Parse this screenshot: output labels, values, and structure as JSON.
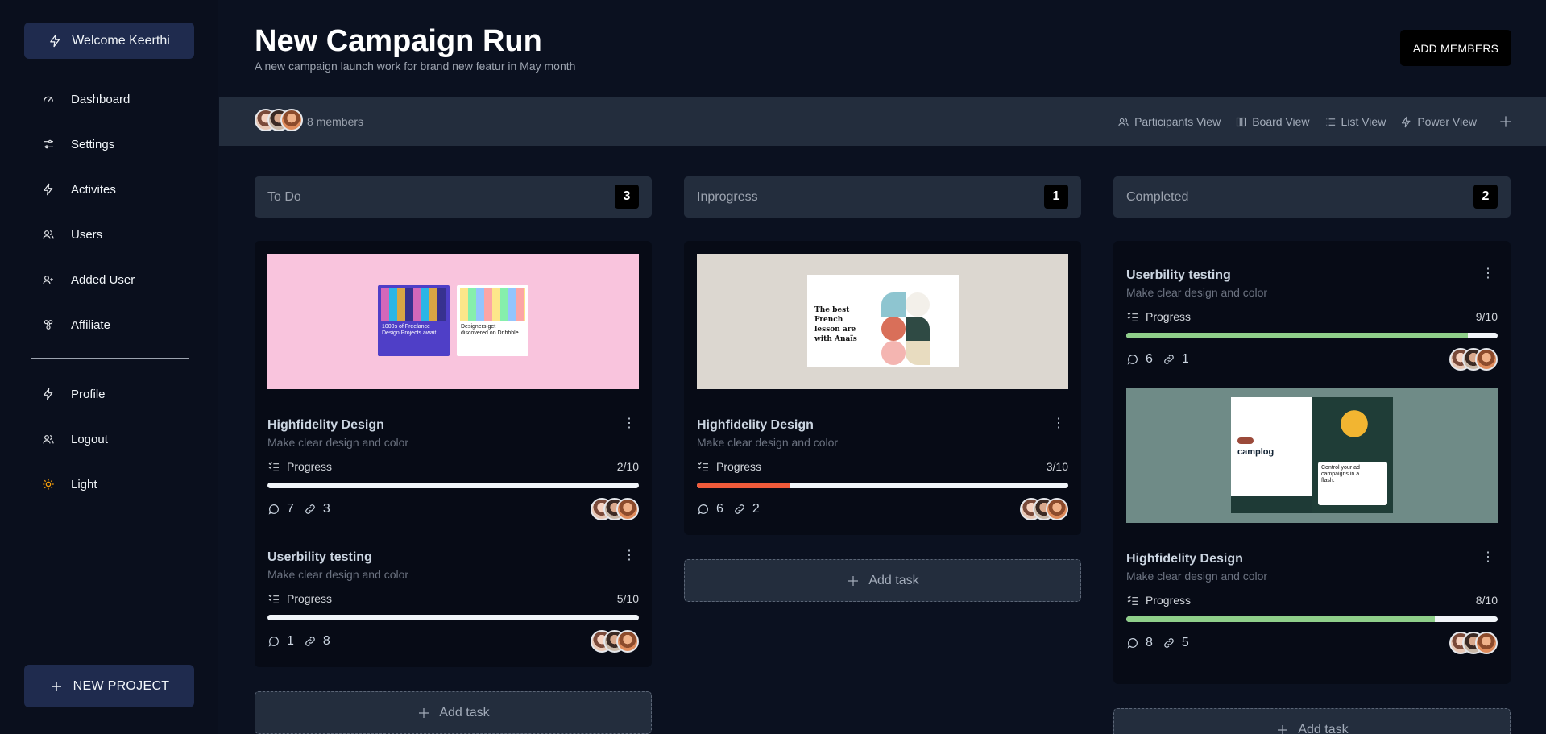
{
  "sidebar": {
    "welcome": "Welcome Keerthi",
    "items": [
      {
        "label": "Dashboard",
        "icon": "gauge-icon"
      },
      {
        "label": "Settings",
        "icon": "sliders-icon"
      },
      {
        "label": "Activites",
        "icon": "bolt-icon"
      },
      {
        "label": "Users",
        "icon": "users-icon"
      },
      {
        "label": "Added User",
        "icon": "user-plus-icon"
      },
      {
        "label": "Affiliate",
        "icon": "affiliate-icon"
      }
    ],
    "bottom_items": [
      {
        "label": "Profile",
        "icon": "bolt-icon"
      },
      {
        "label": "Logout",
        "icon": "users-icon"
      },
      {
        "label": "Light",
        "icon": "sun-icon"
      }
    ],
    "new_project": "NEW PROJECT"
  },
  "header": {
    "title": "New Campaign Run",
    "subtitle": "A new campaign launch work for brand new featur in May month",
    "add_members": "ADD MEMBERS"
  },
  "toolbar": {
    "members": "8 members",
    "views": [
      "Participants View",
      "Board View",
      "List View",
      "Power View"
    ]
  },
  "columns": [
    {
      "name": "To Do",
      "count": "3",
      "cards": [
        {
          "title": "Highfidelity Design",
          "subtitle": "Make clear design and color",
          "progress_label": "Progress",
          "progress": "2/10",
          "comments": "7",
          "links": "3",
          "thumb_text_a": "1000s of Freelance Design Projects await",
          "thumb_text_b": "Designers get discovered on Dribbble"
        },
        {
          "title": "Userbility testing",
          "subtitle": "Make clear design and color",
          "progress_label": "Progress",
          "progress": "5/10",
          "comments": "1",
          "links": "8"
        }
      ],
      "add_task": "Add task"
    },
    {
      "name": "Inprogress",
      "count": "1",
      "cards": [
        {
          "title": "Highfidelity Design",
          "subtitle": "Make clear design and color",
          "progress_label": "Progress",
          "progress": "3/10",
          "comments": "6",
          "links": "2",
          "thumb_text": "The best French lesson are with Anaïs"
        }
      ],
      "add_task": "Add task"
    },
    {
      "name": "Completed",
      "count": "2",
      "cards": [
        {
          "title": "Userbility testing",
          "subtitle": "Make clear design and color",
          "progress_label": "Progress",
          "progress": "9/10",
          "comments": "6",
          "links": "1"
        },
        {
          "title": "Highfidelity Design",
          "subtitle": "Make clear design and color",
          "progress_label": "Progress",
          "progress": "8/10",
          "comments": "8",
          "links": "5",
          "thumb_brand": "camplog",
          "thumb_text": "Control your ad campaigns in a flash."
        }
      ],
      "add_task": "Add task"
    }
  ],
  "colors": {
    "accent": "#1f2b4e",
    "progress_red": "#f05a3a",
    "progress_green": "#8fcf8a"
  }
}
